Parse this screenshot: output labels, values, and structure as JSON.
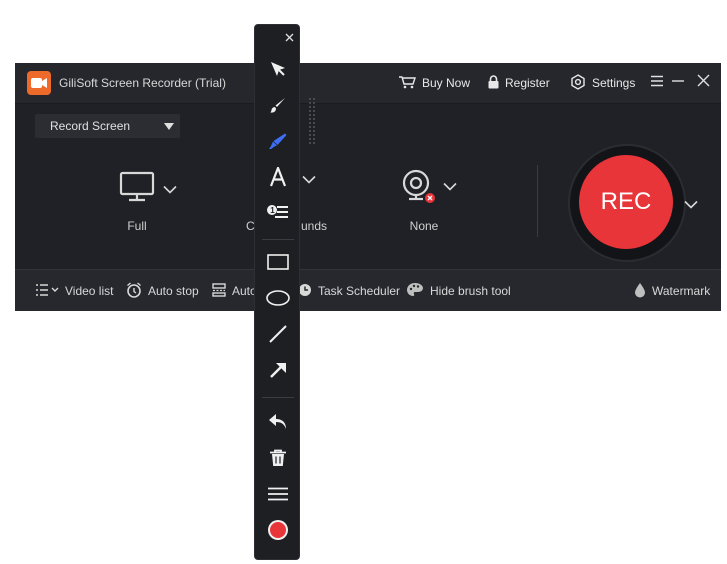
{
  "titlebar": {
    "title": "GiliSoft Screen Recorder (Trial)",
    "buy_now": "Buy Now",
    "register": "Register",
    "settings": "Settings"
  },
  "mode_select": {
    "value": "Record Screen"
  },
  "sources": {
    "screen_label": "Full",
    "audio_label_left": "Com",
    "audio_label_right": "unds",
    "webcam_label": "None"
  },
  "rec_button": {
    "label": "REC"
  },
  "bottombar": {
    "video_list": "Video list",
    "auto_stop": "Auto stop",
    "auto_split": "Auto",
    "task_scheduler": "Task Scheduler",
    "hide_brush": "Hide brush tool",
    "watermark": "Watermark"
  },
  "colors": {
    "accent_orange": "#ee6a2a",
    "rec_red": "#e8353a",
    "highlighter_blue": "#3d6ef5",
    "app_bg": "#1f2126"
  },
  "toolbar_icons": [
    "close-icon",
    "cursor-icon",
    "brush-icon",
    "highlighter-icon",
    "text-icon",
    "number-list-icon",
    "rectangle-icon",
    "ellipse-icon",
    "line-icon",
    "arrow-icon",
    "undo-icon",
    "trash-icon",
    "menu-icon",
    "record-dot-icon"
  ]
}
